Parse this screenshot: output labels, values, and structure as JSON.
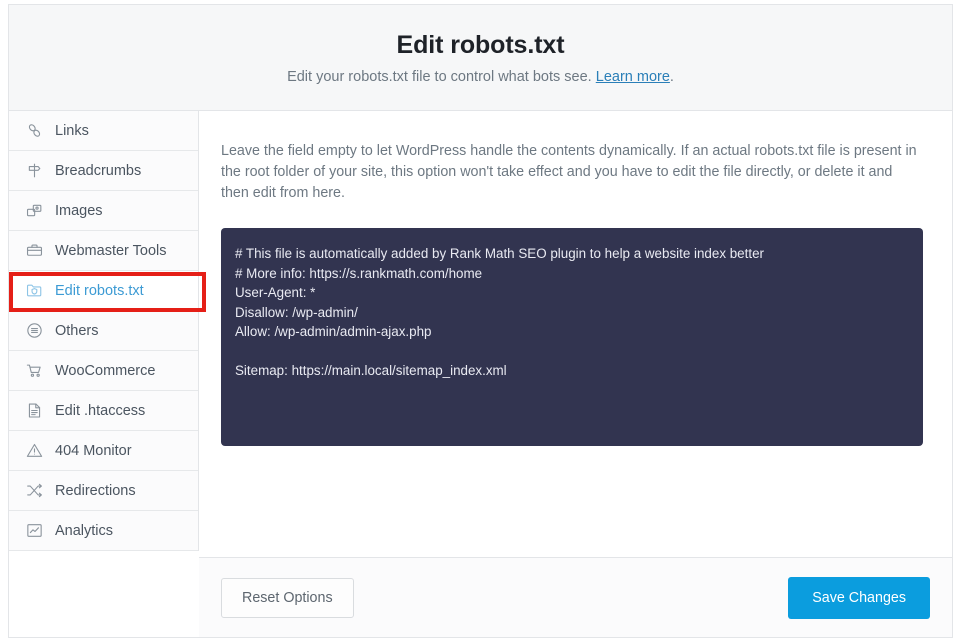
{
  "header": {
    "title": "Edit robots.txt",
    "subtitle_before": "Edit your robots.txt file to control what bots see. ",
    "link_label": "Learn more",
    "subtitle_after": "."
  },
  "sidebar": {
    "items": [
      {
        "label": "Links",
        "icon": "link-icon",
        "active": false
      },
      {
        "label": "Breadcrumbs",
        "icon": "signpost-icon",
        "active": false
      },
      {
        "label": "Images",
        "icon": "images-icon",
        "active": false
      },
      {
        "label": "Webmaster Tools",
        "icon": "briefcase-icon",
        "active": false
      },
      {
        "label": "Edit robots.txt",
        "icon": "folder-shield-icon",
        "active": true
      },
      {
        "label": "Others",
        "icon": "list-circle-icon",
        "active": false
      },
      {
        "label": "WooCommerce",
        "icon": "shopping-cart-icon",
        "active": false
      },
      {
        "label": "Edit .htaccess",
        "icon": "document-icon",
        "active": false
      },
      {
        "label": "404 Monitor",
        "icon": "warning-triangle-icon",
        "active": false
      },
      {
        "label": "Redirections",
        "icon": "shuffle-icon",
        "active": false
      },
      {
        "label": "Analytics",
        "icon": "chart-icon",
        "active": false
      }
    ]
  },
  "main": {
    "description": "Leave the field empty to let WordPress handle the contents dynamically. If an actual robots.txt file is present in the root folder of your site, this option won't take effect and you have to edit the file directly, or delete it and then edit from here.",
    "editor_value": "# This file is automatically added by Rank Math SEO plugin to help a website index better\n# More info: https://s.rankmath.com/home\nUser-Agent: *\nDisallow: /wp-admin/\nAllow: /wp-admin/admin-ajax.php\n\nSitemap: https://main.local/sitemap_index.xml"
  },
  "footer": {
    "reset_label": "Reset Options",
    "save_label": "Save Changes"
  },
  "colors": {
    "accent_blue": "#0b9dde",
    "link_blue": "#2a7fb8",
    "editor_bg": "#323450",
    "highlight_red": "#e51f17",
    "active_item_text": "#3d9bd4"
  }
}
